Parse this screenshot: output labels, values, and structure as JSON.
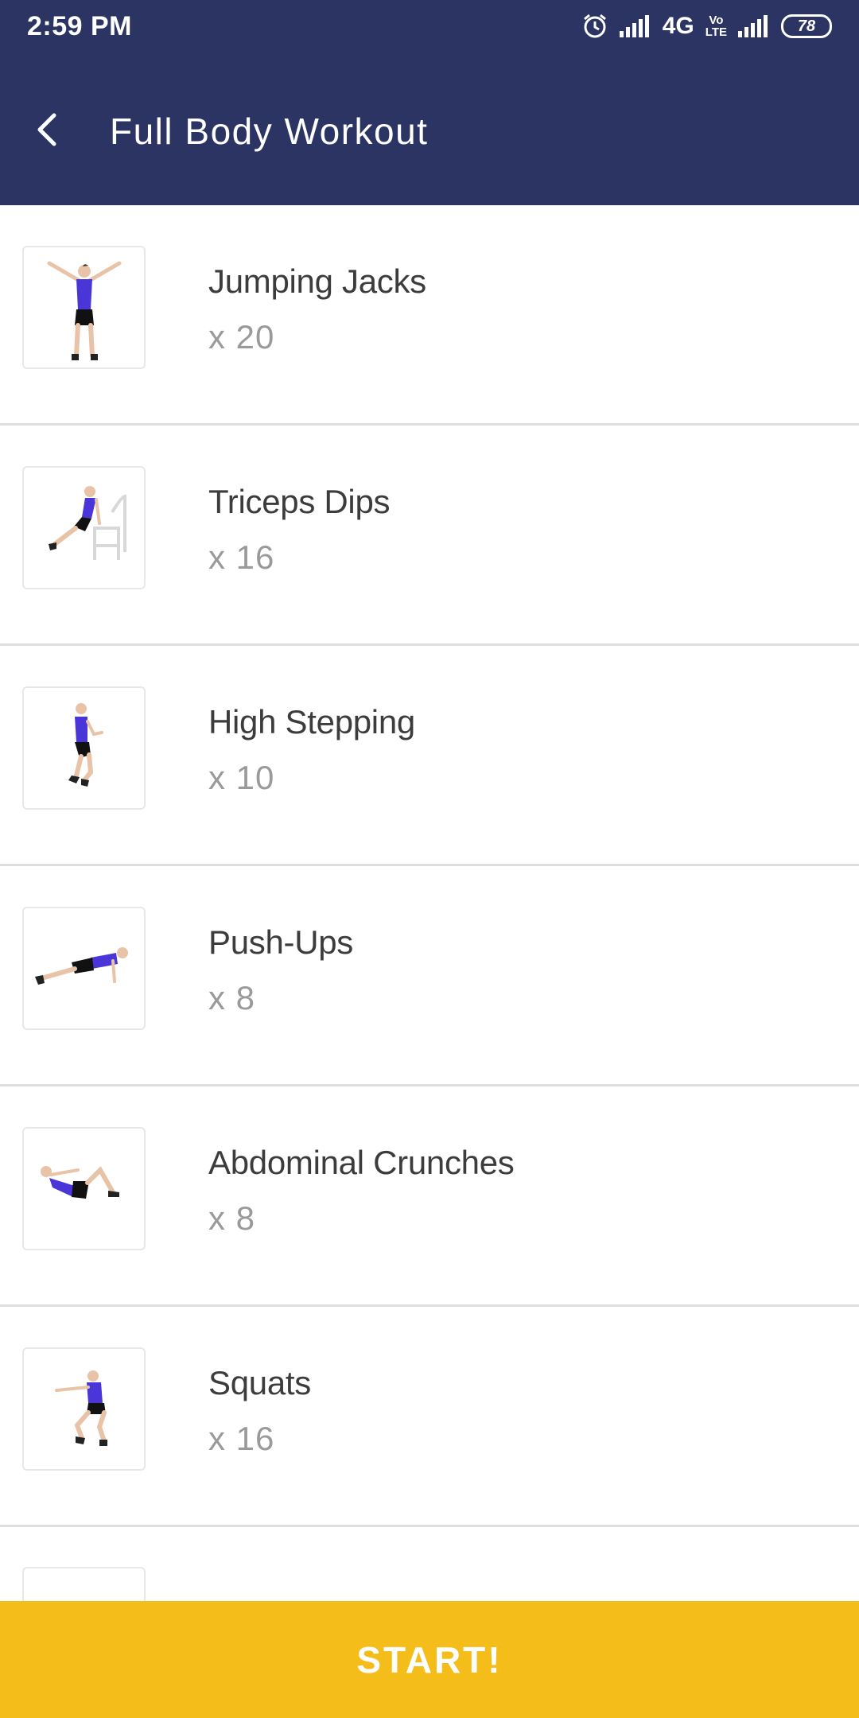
{
  "status_bar": {
    "time": "2:59 PM",
    "network": "4G",
    "volte": [
      "Vo",
      "LTE"
    ],
    "battery": "78"
  },
  "toolbar": {
    "title": "Full Body Workout",
    "back_icon": "arrow-back-icon"
  },
  "exercises": [
    {
      "name": "Jumping Jacks",
      "reps": "x 20"
    },
    {
      "name": "Triceps Dips",
      "reps": "x 16"
    },
    {
      "name": "High Stepping",
      "reps": "x 10"
    },
    {
      "name": "Push-Ups",
      "reps": "x 8"
    },
    {
      "name": "Abdominal Crunches",
      "reps": "x 8"
    },
    {
      "name": "Squats",
      "reps": "x 16"
    }
  ],
  "start_button": {
    "label": "START!"
  },
  "colors": {
    "header": "#2b3462",
    "accent": "#f5bd1a",
    "shirt": "#4a35d8"
  }
}
